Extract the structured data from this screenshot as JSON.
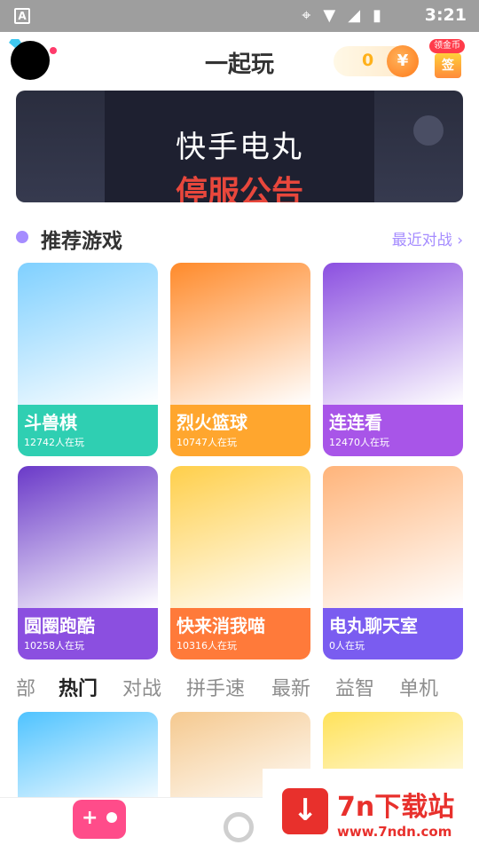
{
  "status_bar": {
    "time": "3:21"
  },
  "header": {
    "title": "一起玩",
    "coin_count": "0",
    "coin_symbol": "¥",
    "claim_label": "领金币",
    "sign_label": "签"
  },
  "banner": {
    "logo_text": "快手电丸",
    "notice": "停服公告"
  },
  "section": {
    "title": "推荐游戏",
    "link": "最近对战 ›"
  },
  "games": [
    {
      "name": "斗兽棋",
      "players": "12742人在玩",
      "color": "#2fcfb2",
      "art": "#7fd0ff"
    },
    {
      "name": "烈火篮球",
      "players": "10747人在玩",
      "color": "#ffa62e",
      "art": "#ff8a2a"
    },
    {
      "name": "连连看",
      "players": "12470人在玩",
      "color": "#a855e8",
      "art": "#8b4fe0"
    },
    {
      "name": "圆圈跑酷",
      "players": "10258人在玩",
      "color": "#8b4fe0",
      "art": "#6a39c8"
    },
    {
      "name": "快来消我喵",
      "players": "10316人在玩",
      "color": "#ff7a3a",
      "art": "#ffcf4a"
    },
    {
      "name": "电丸聊天室",
      "players": "0人在玩",
      "color": "#7a5cf0",
      "art": "#ffb47a"
    }
  ],
  "tabs": [
    "部",
    "热门",
    "对战",
    "拼手速",
    "最新",
    "益智",
    "单机"
  ],
  "active_tab": "热门",
  "bottom_cards": [
    {
      "color": "#4fc3ff"
    },
    {
      "color": "#f5c98f"
    },
    {
      "color": "#ffe25a"
    }
  ],
  "watermark": {
    "badge": "↓",
    "name": "7n下载站",
    "url": "www.7ndn.com"
  }
}
